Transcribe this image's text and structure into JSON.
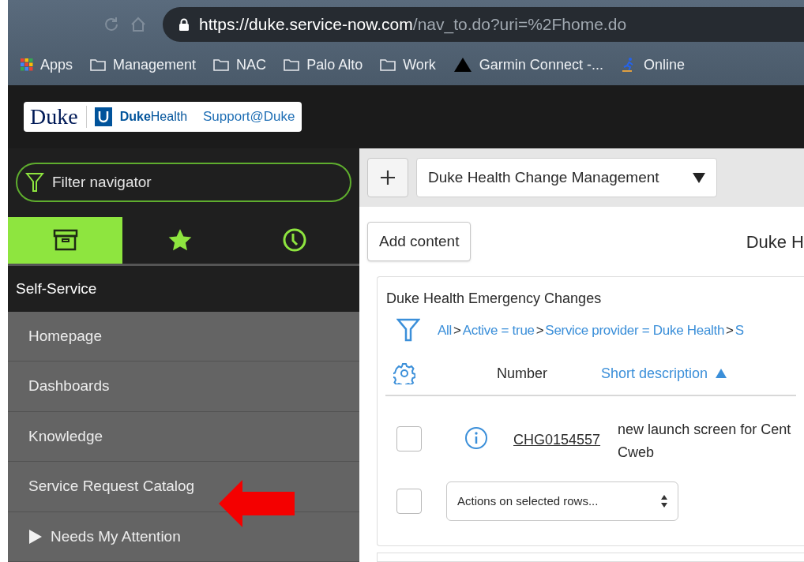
{
  "browser": {
    "url_host": "https://duke.service-now.com",
    "url_path": "/nav_to.do?uri=%2Fhome.do",
    "bookmarks": [
      {
        "label": "Apps",
        "kind": "apps"
      },
      {
        "label": "Management",
        "kind": "folder"
      },
      {
        "label": "NAC",
        "kind": "folder"
      },
      {
        "label": "Palo Alto",
        "kind": "folder"
      },
      {
        "label": "Work",
        "kind": "folder"
      },
      {
        "label": "Garmin Connect -...",
        "kind": "triangle"
      },
      {
        "label": "Online",
        "kind": "runner"
      }
    ]
  },
  "header": {
    "logo_university": "Duke",
    "logo_health": "**Duke**Health",
    "logo_support": "Support@Duke"
  },
  "navigator": {
    "filter": {
      "placeholder": "Filter navigator"
    },
    "tabs": [
      {
        "kind": "all",
        "selected": true
      },
      {
        "kind": "favorites",
        "selected": false
      },
      {
        "kind": "history",
        "selected": false
      }
    ],
    "section": "Self-Service",
    "items": [
      {
        "label": "Homepage",
        "kind": "link"
      },
      {
        "label": "Dashboards",
        "kind": "link"
      },
      {
        "label": "Knowledge",
        "kind": "link"
      },
      {
        "label": "Service Request Catalog",
        "kind": "link"
      },
      {
        "label": "Needs My Attention",
        "kind": "group",
        "expanded": false
      }
    ]
  },
  "dashboard": {
    "selector": "Duke Health Change Management",
    "add_button": "Add content",
    "title": "Duke H",
    "widget": {
      "title": "Duke Health Emergency Changes",
      "breadcrumb_separator": ">",
      "breadcrumbs": [
        "All",
        "Active = true",
        "Service provider = Duke Health",
        "S"
      ],
      "columns": [
        {
          "label": "Number",
          "sort_ascending": false
        },
        {
          "label": "Short description",
          "sort_ascending": true
        }
      ],
      "rows": [
        {
          "checked": false,
          "number": "CHG0154557",
          "description": [
            "new launch screen for Cent",
            "Cweb"
          ]
        }
      ],
      "footer": {
        "checked": false,
        "actions": "Actions on selected rows..."
      }
    }
  }
}
